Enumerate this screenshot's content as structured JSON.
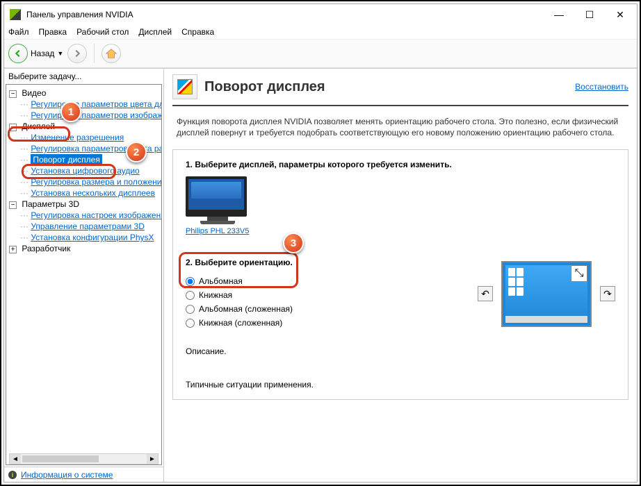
{
  "window": {
    "title": "Панель управления NVIDIA"
  },
  "menubar": [
    "Файл",
    "Правка",
    "Рабочий стол",
    "Дисплей",
    "Справка"
  ],
  "toolbar": {
    "back_label": "Назад"
  },
  "sidebar": {
    "prompt": "Выберите задачу...",
    "video": {
      "label": "Видео",
      "items": [
        "Регулировка параметров цвета для вид",
        "Регулировка параметров изображения д"
      ]
    },
    "display": {
      "label": "Дисплей",
      "items": [
        "Изменение разрешения",
        "Регулировка параметров цвета рабочег",
        "Поворот дисплея",
        "Установка цифрового аудио",
        "Регулировка размера и положения рабо",
        "Установка нескольких дисплеев"
      ]
    },
    "params3d": {
      "label": "Параметры 3D",
      "items": [
        "Регулировка настроек изображения с пр",
        "Управление параметрами 3D",
        "Установка конфигурации PhysX"
      ]
    },
    "developer": {
      "label": "Разработчик"
    },
    "footer_link": "Информация о системе"
  },
  "content": {
    "title": "Поворот дисплея",
    "restore": "Восстановить",
    "intro": "Функция поворота дисплея NVIDIA позволяет менять ориентацию рабочего стола. Это полезно, если физический дисплей повернут и требуется подобрать соответствующую его новому положению ориентацию рабочего стола.",
    "step1_title": "1. Выберите дисплей, параметры которого требуется изменить.",
    "monitor_label": "Philips PHL 233V5",
    "step2_title": "2. Выберите ориентацию.",
    "orientations": [
      "Альбомная",
      "Книжная",
      "Альбомная (сложенная)",
      "Книжная (сложенная)"
    ],
    "description": "Описание.",
    "scenarios": "Типичные ситуации применения."
  },
  "annotations": {
    "b1": "1",
    "b2": "2",
    "b3": "3"
  }
}
